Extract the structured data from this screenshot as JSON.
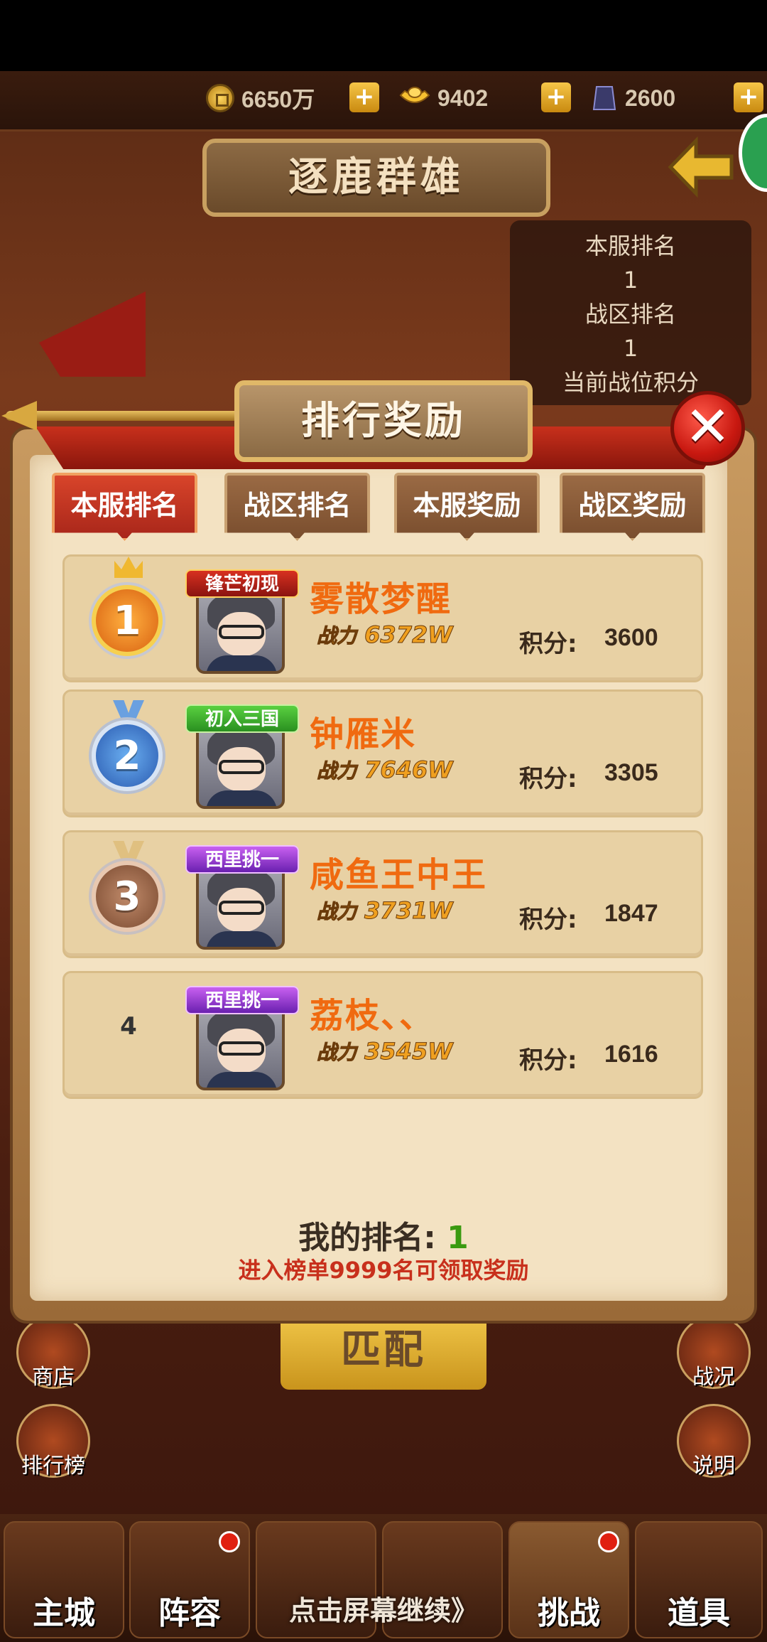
{
  "resources": {
    "gold": "6650万",
    "ingot": "9402",
    "token": "2600"
  },
  "page_title": "逐鹿群雄",
  "info": {
    "server_rank_label": "本服排名",
    "server_rank_value": "1",
    "zone_rank_label": "战区排名",
    "zone_rank_value": "1",
    "score_label": "当前战位积分"
  },
  "match_label": "匹配",
  "side_buttons": {
    "shop": "商店",
    "leaderboard": "排行榜",
    "battle": "战况",
    "help": "说明"
  },
  "modal": {
    "title": "排行奖励",
    "close": "✕",
    "tabs": [
      {
        "label": "本服排名",
        "active": true
      },
      {
        "label": "战区排名",
        "active": false
      },
      {
        "label": "本服奖励",
        "active": false
      },
      {
        "label": "战区奖励",
        "active": false
      }
    ],
    "rows": [
      {
        "rank": "1",
        "title_badge": "锋芒初现",
        "name": "雾散梦醒",
        "power_label": "战力",
        "power": "6372W",
        "score_label": "积分:",
        "score": "3600"
      },
      {
        "rank": "2",
        "title_badge": "初入三国",
        "name": "钟雁米",
        "power_label": "战力",
        "power": "7646W",
        "score_label": "积分:",
        "score": "3305"
      },
      {
        "rank": "3",
        "title_badge": "西里挑一",
        "name": "咸鱼王中王",
        "power_label": "战力",
        "power": "3731W",
        "score_label": "积分:",
        "score": "1847"
      },
      {
        "rank": "4",
        "title_badge": "西里挑一",
        "name": "荔枝、、",
        "power_label": "战力",
        "power": "3545W",
        "score_label": "积分:",
        "score": "1616"
      }
    ],
    "my_rank_label": "我的排名:",
    "my_rank_value": "1",
    "hint": "进入榜单9999名可领取奖励"
  },
  "continue_text": "点击屏幕继续》",
  "bottom_nav": [
    {
      "label": "主城",
      "badge": false
    },
    {
      "label": "阵容",
      "badge": true
    },
    {
      "label": "",
      "badge": false
    },
    {
      "label": "",
      "badge": false
    },
    {
      "label": "挑战",
      "badge": true
    },
    {
      "label": "道具",
      "badge": false
    }
  ],
  "colors": {
    "accent_red": "#c8301c",
    "parchment": "#f3e2c2",
    "name_orange": "#f06a10",
    "rank_green": "#3a9a10"
  }
}
